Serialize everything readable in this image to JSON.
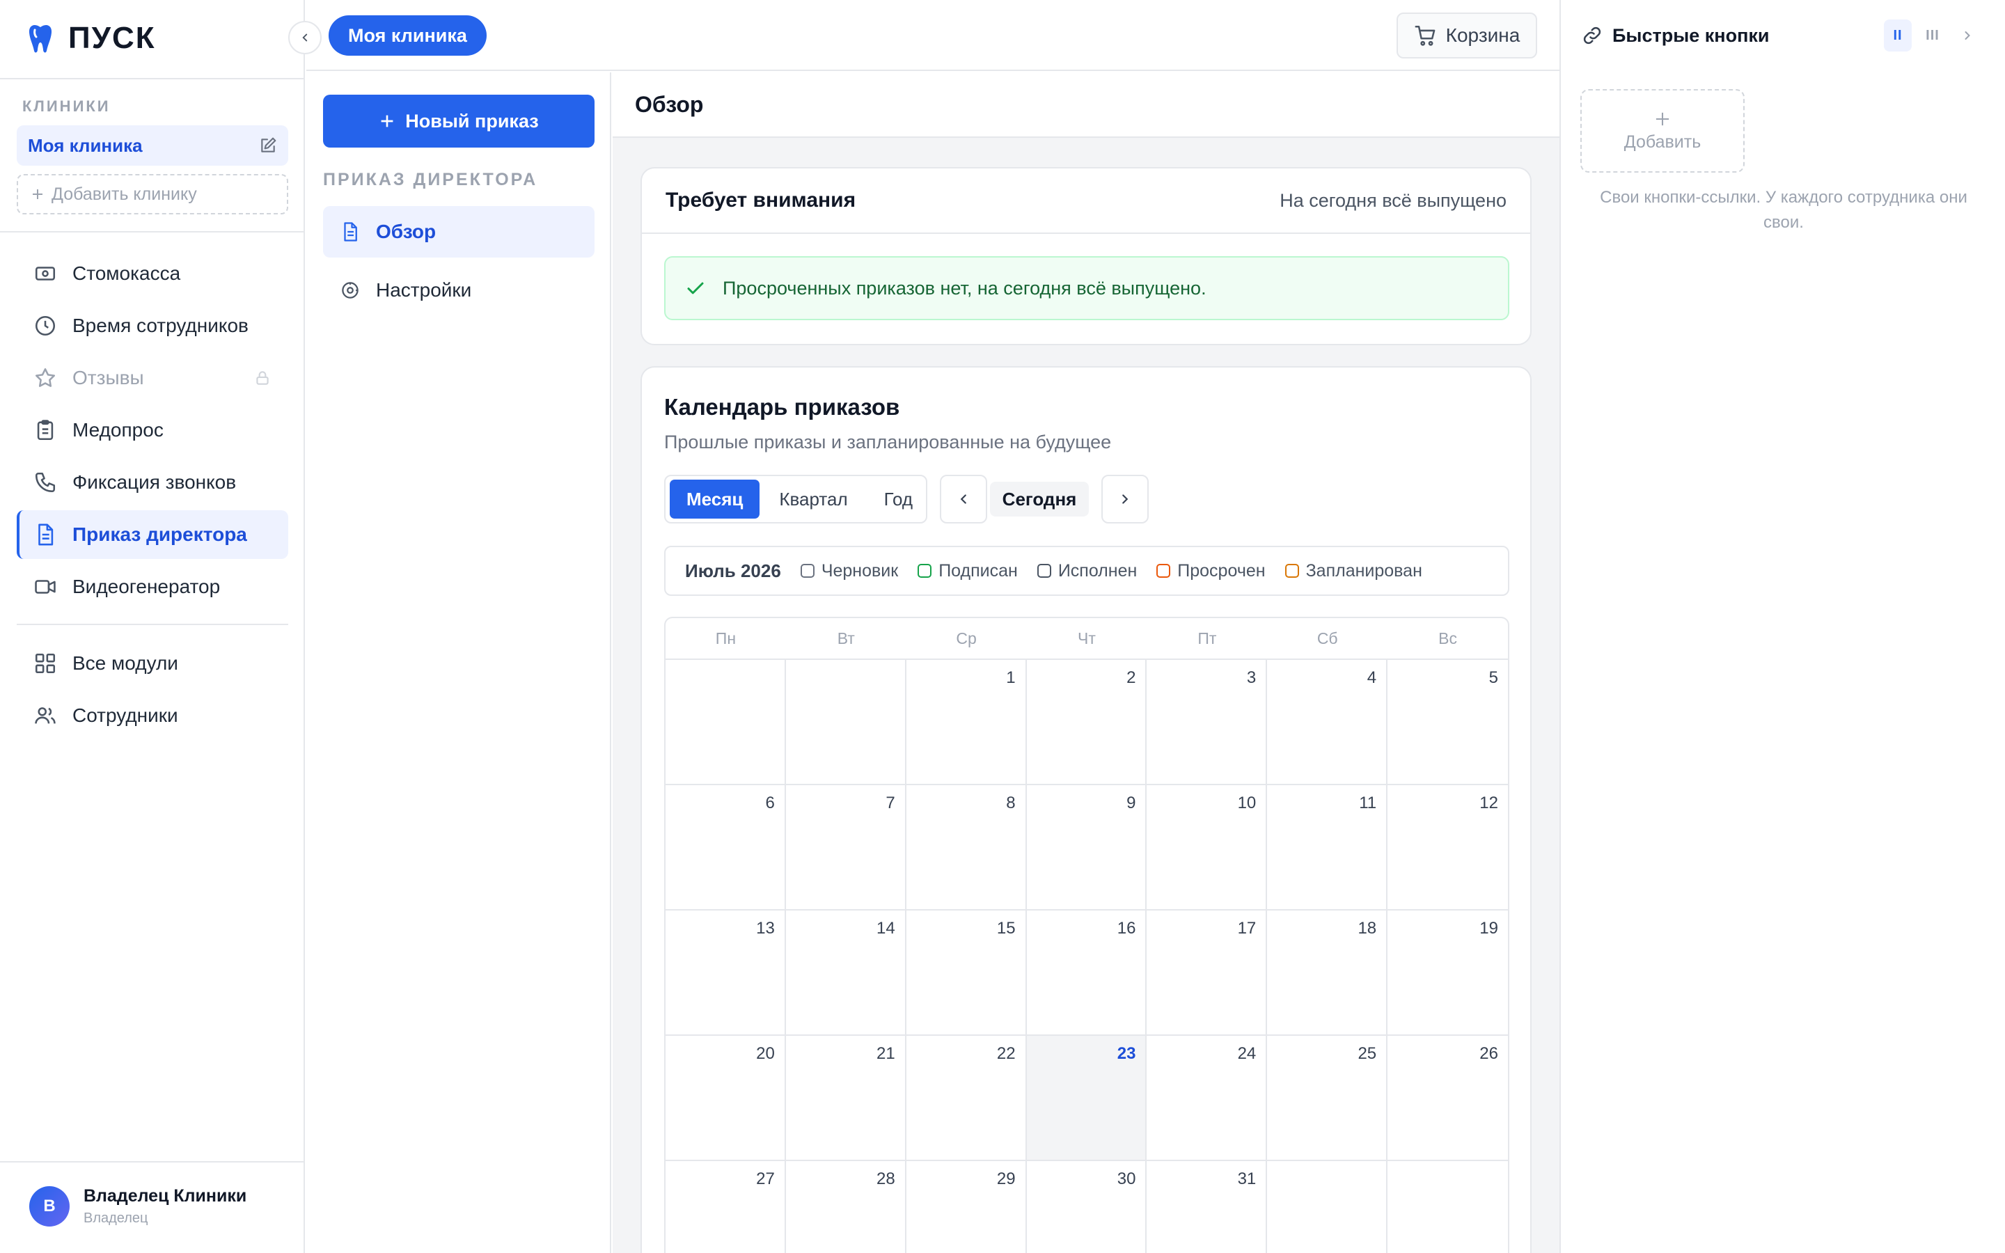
{
  "brand": {
    "name": "ПУСК"
  },
  "sidebar": {
    "clinics_label": "КЛИНИКИ",
    "current_clinic": "Моя клиника",
    "add_clinic": "Добавить клинику",
    "items": [
      {
        "label": "Стомокасса",
        "icon": "cash-register-icon"
      },
      {
        "label": "Время сотрудников",
        "icon": "clock-icon"
      },
      {
        "label": "Отзывы",
        "icon": "star-icon",
        "locked": true
      },
      {
        "label": "Медопрос",
        "icon": "clipboard-icon"
      },
      {
        "label": "Фиксация звонков",
        "icon": "phone-icon"
      },
      {
        "label": "Приказ директора",
        "icon": "document-icon",
        "active": true
      },
      {
        "label": "Видеогенератор",
        "icon": "video-icon"
      }
    ],
    "secondary_items": [
      {
        "label": "Все модули",
        "icon": "grid-icon"
      },
      {
        "label": "Сотрудники",
        "icon": "users-icon"
      }
    ],
    "user": {
      "initial": "В",
      "name": "Владелец Клиники",
      "role": "Владелец"
    }
  },
  "topbar": {
    "clinic_pill": "Моя клиника",
    "cart": "Корзина"
  },
  "subnav": {
    "new_order": "Новый приказ",
    "section_label": "ПРИКАЗ ДИРЕКТОРА",
    "items": [
      {
        "label": "Обзор",
        "active": true
      },
      {
        "label": "Настройки"
      }
    ]
  },
  "main": {
    "title": "Обзор",
    "attention": {
      "title": "Требует внимания",
      "status": "На сегодня всё выпущено",
      "message": "Просроченных приказов нет, на сегодня всё выпущено."
    },
    "calendar": {
      "title": "Календарь приказов",
      "subtitle": "Прошлые приказы и запланированные на будущее",
      "views": [
        "Месяц",
        "Квартал",
        "Год"
      ],
      "active_view": "Месяц",
      "today_button": "Сегодня",
      "month_label": "Июль 2026",
      "legend": [
        {
          "label": "Черновик",
          "color": "#6b7280"
        },
        {
          "label": "Подписан",
          "color": "#16a34a"
        },
        {
          "label": "Исполнен",
          "color": "#4b5563"
        },
        {
          "label": "Просрочен",
          "color": "#ea580c"
        },
        {
          "label": "Запланирован",
          "color": "#d97706"
        }
      ],
      "weekdays": [
        "Пн",
        "Вт",
        "Ср",
        "Чт",
        "Пт",
        "Сб",
        "Вс"
      ],
      "leading_blanks": 2,
      "days_in_month": 31,
      "today": 23,
      "accent": "#2563eb"
    }
  },
  "quick_buttons": {
    "title": "Быстрые кнопки",
    "column_options": [
      "II",
      "III"
    ],
    "active_columns": "II",
    "add_label": "Добавить",
    "hint": "Свои кнопки-ссылки. У каждого сотрудника они свои."
  }
}
